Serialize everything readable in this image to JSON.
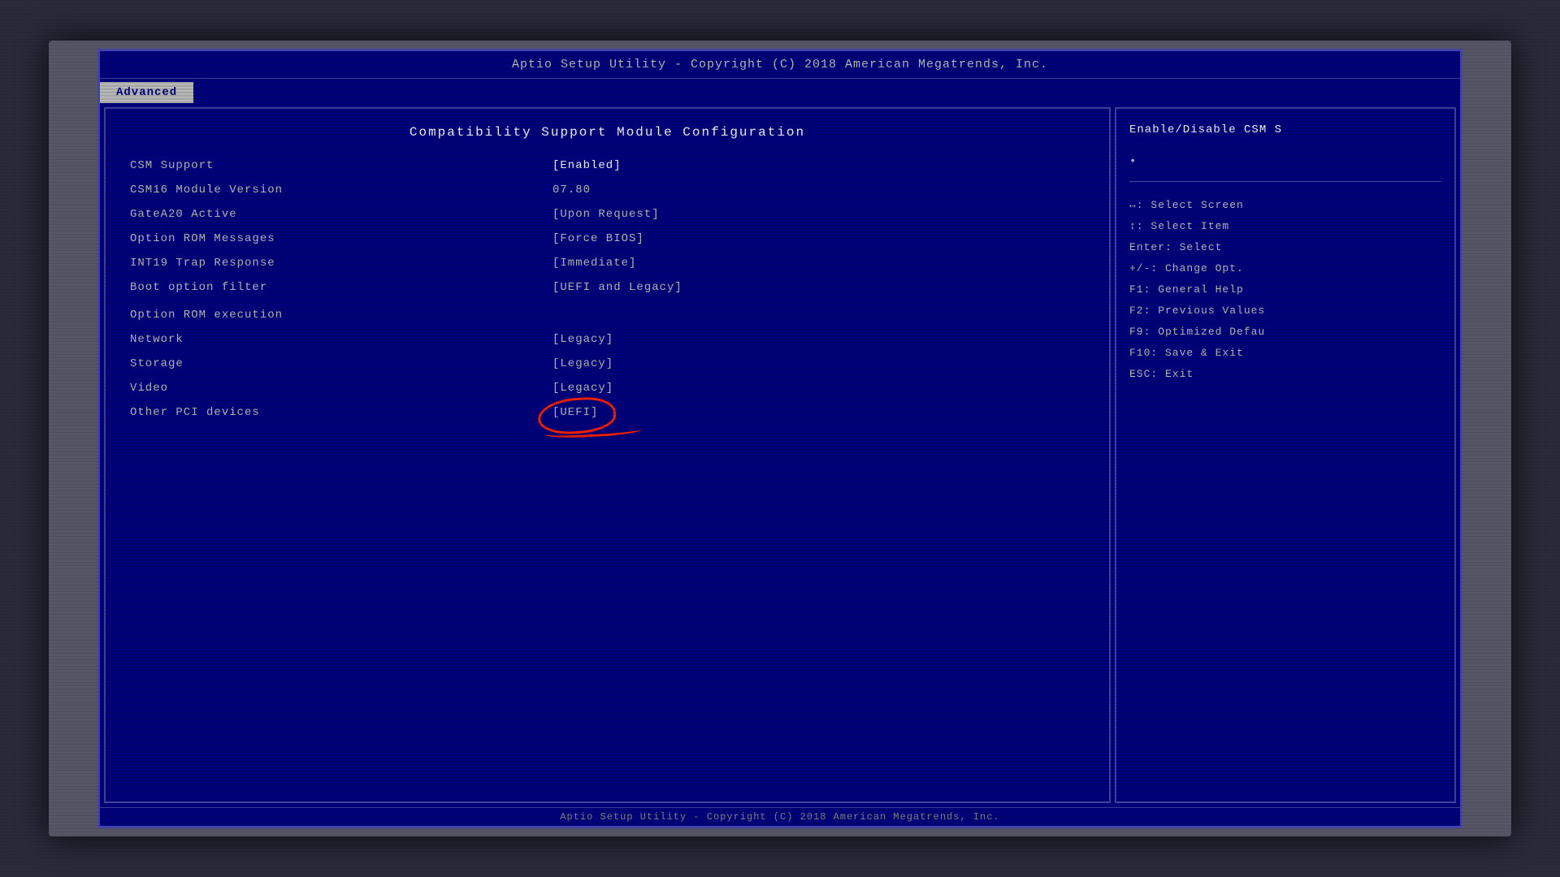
{
  "title_bar": {
    "text": "Aptio Setup Utility - Copyright (C) 2018 American Megatrends, Inc."
  },
  "tabs": [
    {
      "label": "Advanced",
      "active": true
    }
  ],
  "section": {
    "title": "Compatibility Support Module Configuration"
  },
  "config_rows": [
    {
      "label": "CSM Support",
      "value": "[Enabled]"
    },
    {
      "label": "CSM16 Module Version",
      "value": "07.80"
    },
    {
      "label": "GateA20 Active",
      "value": "[Upon Request]"
    },
    {
      "label": "Option ROM Messages",
      "value": "[Force BIOS]"
    },
    {
      "label": "INT19 Trap Response",
      "value": "[Immediate]"
    },
    {
      "label": "Boot option filter",
      "value": "[UEFI and Legacy]"
    }
  ],
  "option_rom_header": "Option ROM execution",
  "option_rom_rows": [
    {
      "label": "Network",
      "value": "[Legacy]"
    },
    {
      "label": "Storage",
      "value": "[Legacy]"
    },
    {
      "label": "Video",
      "value": "[Legacy]"
    },
    {
      "label": "Other PCI devices",
      "value": "[UEFI]",
      "circled": true
    }
  ],
  "sidebar": {
    "description": "Enable/Disable CSM S",
    "dot": "•",
    "keys": [
      "↔: Select Screen",
      "↕: Select Item",
      "Enter: Select",
      "+/-: Change Opt.",
      "F1: General Help",
      "F2: Previous Values",
      "F9: Optimized Defau",
      "F10: Save & Exit",
      "ESC: Exit"
    ]
  },
  "bottom_bar": {
    "text": "Aptio Setup Utility - Copyright (C) 2018 American Megatrends, Inc."
  }
}
